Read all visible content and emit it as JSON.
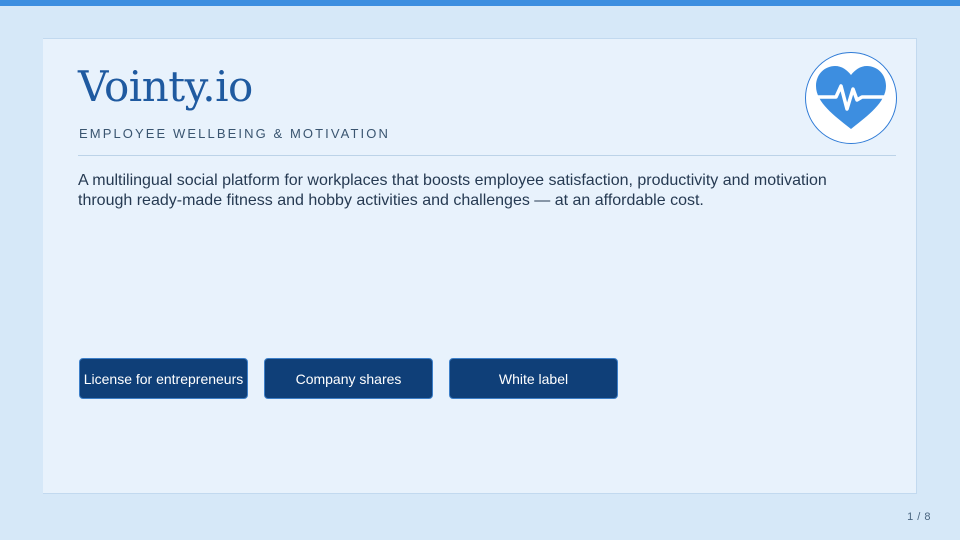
{
  "slide": {
    "title": "Vointy.io",
    "subtitle": "EMPLOYEE WELLBEING & MOTIVATION",
    "description": "A multilingual social platform for workplaces that boosts employee satisfaction, productivity and motivation through ready-made fitness and hobby activities and challenges — at an affordable cost.",
    "logo_icon": "heart-pulse-icon",
    "buttons": [
      {
        "label": "License for entrepreneurs"
      },
      {
        "label": "Company shares"
      },
      {
        "label": "White label"
      }
    ]
  },
  "pagination": {
    "label": "1 / 8"
  },
  "colors": {
    "accent": "#3d8ee0",
    "title": "#1f5aa0",
    "button_bg": "#0f3f78",
    "background": "#d6e8f8",
    "card": "#e8f2fc"
  }
}
